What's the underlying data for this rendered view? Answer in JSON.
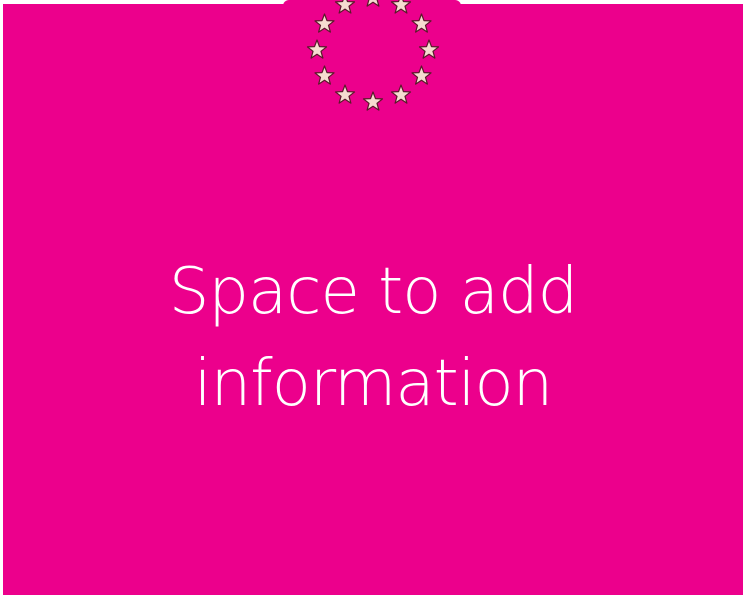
{
  "colors": {
    "background": "#ec008c",
    "text": "#ffffff",
    "star_fill": "#f6dcd0",
    "star_stroke": "#5a1a2a"
  },
  "logo": {
    "icon": "star-ring-icon",
    "star_count": 12
  },
  "placeholder": {
    "line1": "Space to add",
    "line2": "information"
  }
}
